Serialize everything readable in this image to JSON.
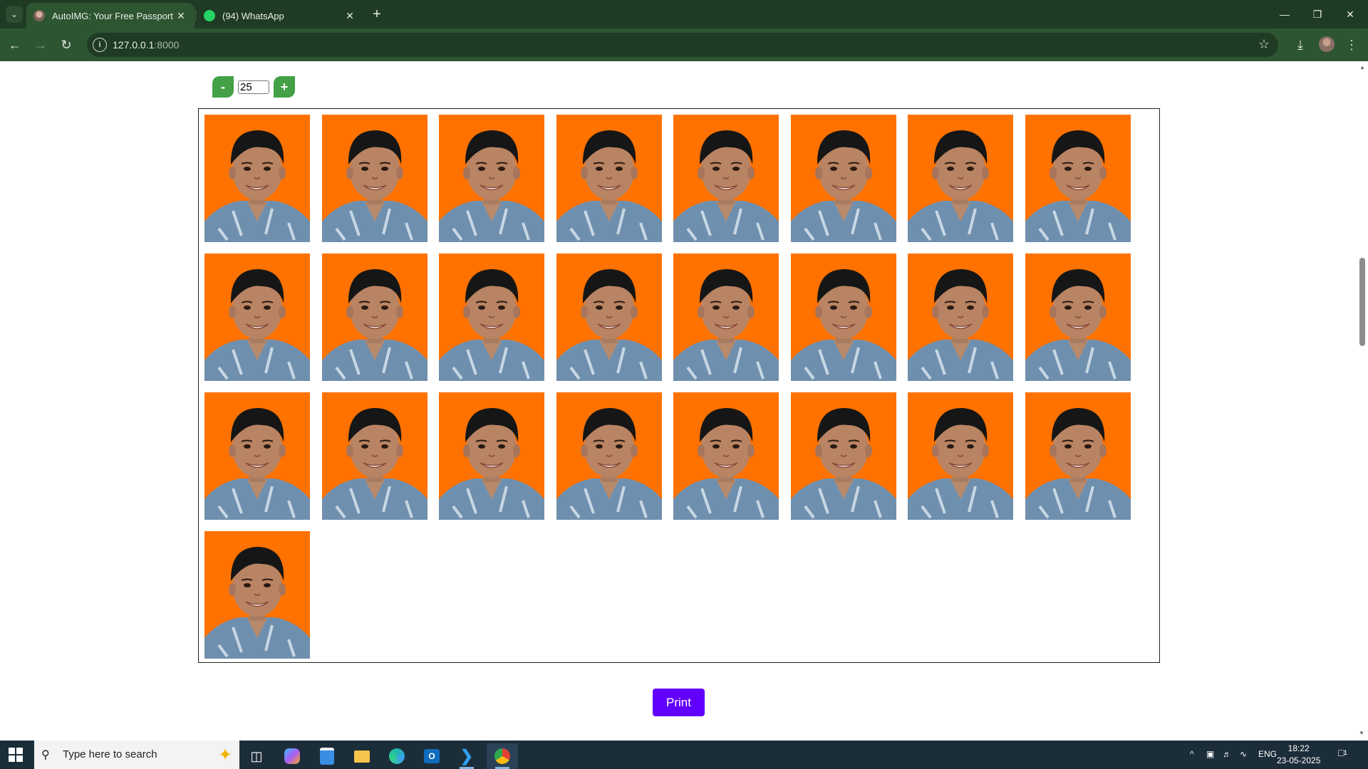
{
  "browser": {
    "tabs": [
      {
        "title": "AutoIMG: Your Free Passport to",
        "active": true
      },
      {
        "title": "(94) WhatsApp",
        "active": false
      }
    ],
    "url_host": "127.0.0.1",
    "url_port": ":8000"
  },
  "page": {
    "copies_value": "25",
    "decrement_label": "-",
    "increment_label": "+",
    "photo_count": 25,
    "photo_background": "#ff7200",
    "print_label": "Print",
    "print_color": "#6200ff",
    "stepper_color": "#43a047"
  },
  "taskbar": {
    "search_placeholder": "Type here to search",
    "language": "ENG",
    "time": "18:22",
    "date": "23-05-2025",
    "notification_count": "1"
  }
}
